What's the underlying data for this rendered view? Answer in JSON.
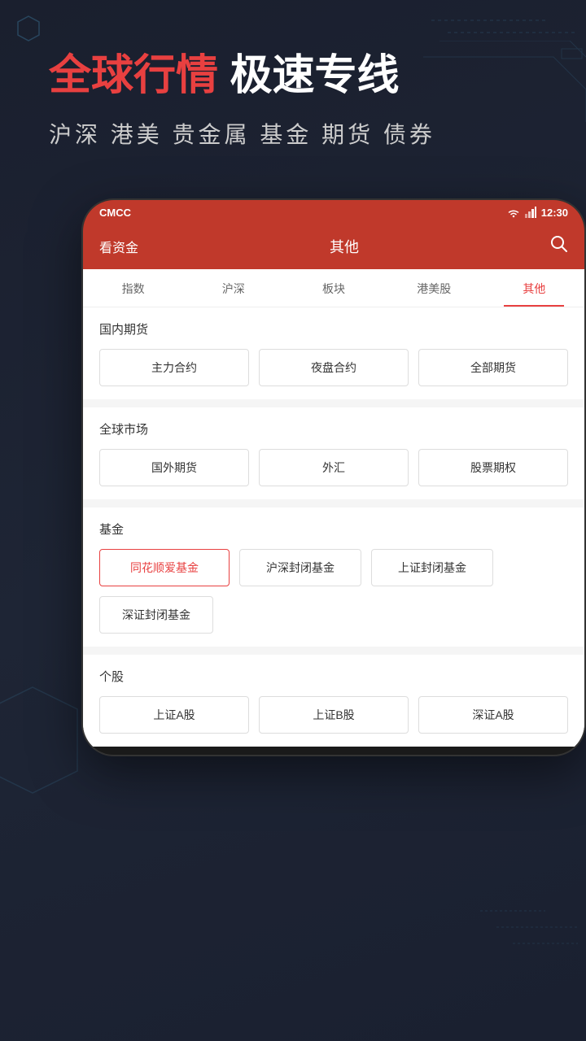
{
  "banner": {
    "title_highlight": "全球行情",
    "title_normal": " 极速专线",
    "subtitle": "沪深 港美 贵金属 基金 期货 债券"
  },
  "status_bar": {
    "carrier": "CMCC",
    "time": "12:30"
  },
  "header": {
    "left": "看资金",
    "center": "其他",
    "search_icon": "🔍"
  },
  "tabs": [
    {
      "label": "指数",
      "active": false
    },
    {
      "label": "沪深",
      "active": false
    },
    {
      "label": "板块",
      "active": false
    },
    {
      "label": "港美股",
      "active": false
    },
    {
      "label": "其他",
      "active": true
    }
  ],
  "sections": [
    {
      "title": "国内期货",
      "buttons": [
        {
          "label": "主力合约",
          "active": false
        },
        {
          "label": "夜盘合约",
          "active": false
        },
        {
          "label": "全部期货",
          "active": false
        }
      ]
    },
    {
      "title": "全球市场",
      "buttons": [
        {
          "label": "国外期货",
          "active": false
        },
        {
          "label": "外汇",
          "active": false
        },
        {
          "label": "股票期权",
          "active": false
        }
      ]
    },
    {
      "title": "基金",
      "buttons": [
        {
          "label": "同花顺爱基金",
          "active": true
        },
        {
          "label": "沪深封闭基金",
          "active": false
        },
        {
          "label": "上证封闭基金",
          "active": false
        },
        {
          "label": "深证封闭基金",
          "active": false,
          "row2": true
        }
      ]
    },
    {
      "title": "个股",
      "buttons": [
        {
          "label": "上证A股",
          "active": false
        },
        {
          "label": "上证B股",
          "active": false
        },
        {
          "label": "深证A股",
          "active": false
        }
      ]
    }
  ]
}
